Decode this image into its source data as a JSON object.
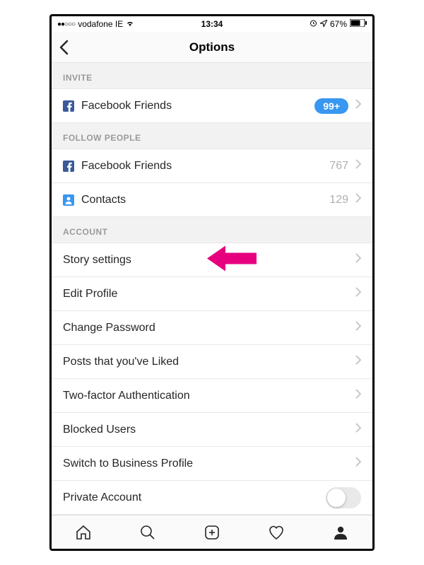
{
  "status": {
    "carrier": "vodafone IE",
    "time": "13:34",
    "battery": "67%"
  },
  "nav": {
    "title": "Options"
  },
  "sections": {
    "invite": {
      "header": "INVITE",
      "facebook_label": "Facebook Friends",
      "facebook_badge": "99+"
    },
    "follow": {
      "header": "FOLLOW PEOPLE",
      "facebook_label": "Facebook Friends",
      "facebook_count": "767",
      "contacts_label": "Contacts",
      "contacts_count": "129"
    },
    "account": {
      "header": "ACCOUNT",
      "story_settings": "Story settings",
      "edit_profile": "Edit Profile",
      "change_password": "Change Password",
      "posts_liked": "Posts that you've Liked",
      "two_factor": "Two-factor Authentication",
      "blocked_users": "Blocked Users",
      "switch_business": "Switch to Business Profile",
      "private_account": "Private Account"
    }
  },
  "callout": {
    "color": "#e6007e"
  }
}
